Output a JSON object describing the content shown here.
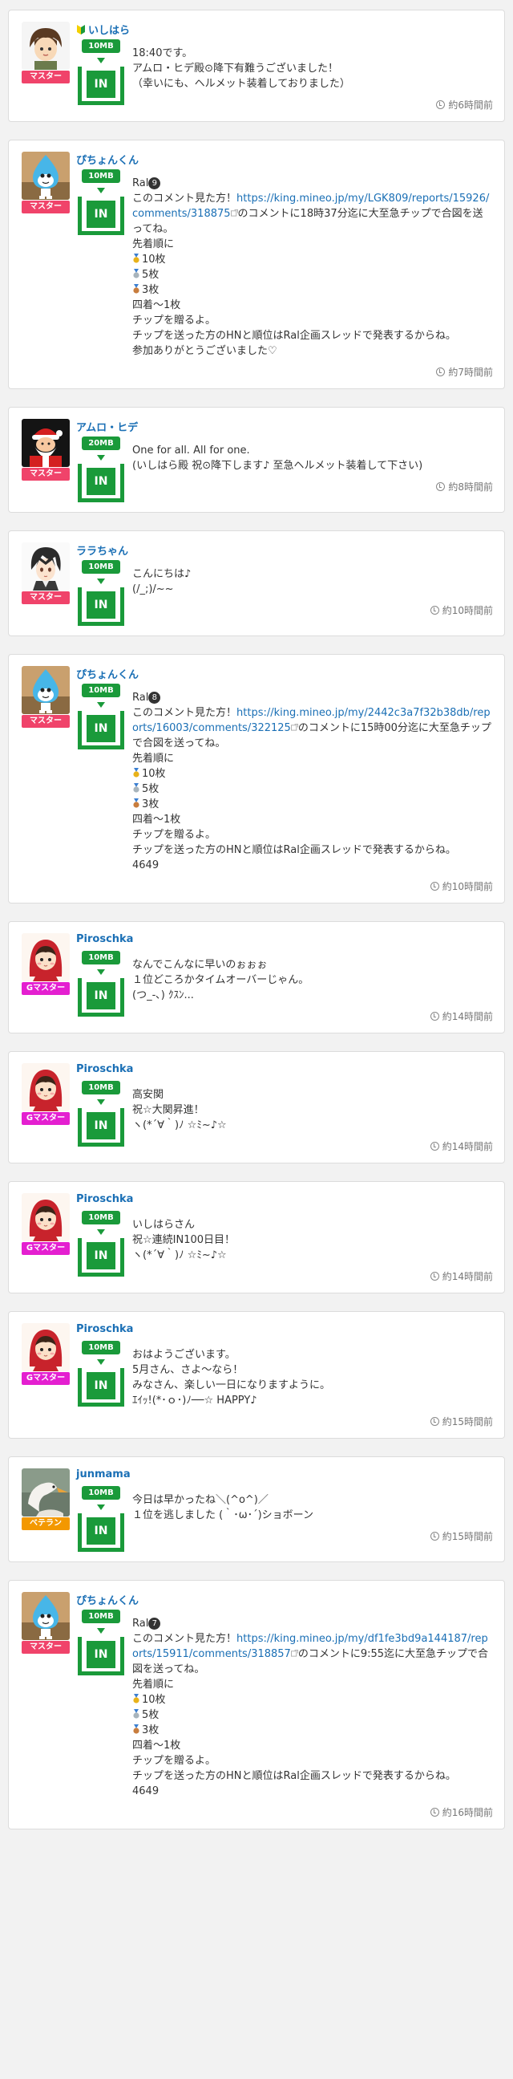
{
  "colors": {
    "master": "#f0436a",
    "g_master": "#e41fd0",
    "veteran": "#f39800",
    "green": "#1a9a3a",
    "link": "#1a6fb5"
  },
  "posts": [
    {
      "name": "いしはら",
      "rank": "マスター",
      "rank_type": "master",
      "mb": "10MB",
      "in": "IN",
      "avatar": "avatar-boy",
      "lines": [
        "18:40です。",
        "アムロ・ヒデ殿⊙降下有難うございました！",
        "（幸いにも、ヘルメット装着しておりました）"
      ],
      "time": "約6時間前"
    },
    {
      "name": "ぴちょんくん",
      "rank": "マスター",
      "rank_type": "master",
      "mb": "10MB",
      "in": "IN",
      "avatar": "avatar-drop",
      "ral_label": "Ral",
      "ral_num": "9",
      "pre": "このコメント見た方！",
      "url": "https://king.mineo.jp/my/LGK809/reports/15926/comments/318875",
      "post": "のコメントに18時37分迄に大至急チップで合図を送ってね。",
      "lines": [
        "先着順に",
        "10枚",
        "5枚",
        "3枚",
        "四着〜1枚",
        "チップを贈るよ。",
        "チップを送った方のHNと順位はRal企画スレッドで発表するからね。",
        "参加ありがとうございました♡"
      ],
      "time": "約7時間前"
    },
    {
      "name": "アムロ・ヒデ",
      "rank": "マスター",
      "rank_type": "master",
      "mb": "20MB",
      "in": "IN",
      "avatar": "avatar-santa",
      "lines": [
        "One for all. All for one.",
        "(いしはら殿 祝⊙降下します♪ 至急ヘルメット装着して下さい)"
      ],
      "time": "約8時間前"
    },
    {
      "name": "ララちゃん",
      "rank": "マスター",
      "rank_type": "master",
      "mb": "10MB",
      "in": "IN",
      "avatar": "avatar-anime",
      "lines": [
        "こんにちは♪",
        "(/_;)/~~"
      ],
      "time": "約10時間前"
    },
    {
      "name": "ぴちょんくん",
      "rank": "マスター",
      "rank_type": "master",
      "mb": "10MB",
      "in": "IN",
      "avatar": "avatar-drop",
      "ral_label": "Ral",
      "ral_num": "8",
      "pre": "このコメント見た方！",
      "url": "https://king.mineo.jp/my/2442c3a7f32b38db/reports/16003/comments/322125",
      "post": "のコメントに15時00分迄に大至急チップで合図を送ってね。",
      "lines": [
        "先着順に",
        "10枚",
        "5枚",
        "3枚",
        "四着〜1枚",
        "チップを贈るよ。",
        "チップを送った方のHNと順位はRal企画スレッドで発表するからね。",
        "4649"
      ],
      "time": "約10時間前"
    },
    {
      "name": "Piroschka",
      "rank": "Gマスター",
      "rank_type": "g_master",
      "mb": "10MB",
      "in": "IN",
      "avatar": "avatar-hood",
      "lines": [
        "なんでこんなに早いのぉぉぉ",
        "１位どころかタイムオーバーじゃん。",
        "(つ_-､) ｸｽﾝ..."
      ],
      "time": "約14時間前"
    },
    {
      "name": "Piroschka",
      "rank": "Gマスター",
      "rank_type": "g_master",
      "mb": "10MB",
      "in": "IN",
      "avatar": "avatar-hood",
      "lines": [
        "高安関",
        "祝☆大関昇進！",
        "ヽ(*´∀｀)ﾉ ☆ﾐ~♪☆"
      ],
      "time": "約14時間前"
    },
    {
      "name": "Piroschka",
      "rank": "Gマスター",
      "rank_type": "g_master",
      "mb": "10MB",
      "in": "IN",
      "avatar": "avatar-hood",
      "lines": [
        "いしはらさん",
        "祝☆連続IN100日目！",
        "ヽ(*´∀｀)ﾉ ☆ﾐ~♪☆"
      ],
      "time": "約14時間前"
    },
    {
      "name": "Piroschka",
      "rank": "Gマスター",
      "rank_type": "g_master",
      "mb": "10MB",
      "in": "IN",
      "avatar": "avatar-hood",
      "lines": [
        "おはようございます。",
        "5月さん、さよ〜なら！",
        "みなさん、楽しい一日になりますように。",
        "ｴｲｯ!(*･ｏ･)ﾉ──☆ HAPPY♪"
      ],
      "time": "約15時間前"
    },
    {
      "name": "junmama",
      "rank": "ベテラン",
      "rank_type": "veteran",
      "mb": "10MB",
      "in": "IN",
      "avatar": "avatar-bird",
      "lines": [
        "今日は早かったね＼(^o^)／",
        "１位を逃しました (｀･ω･´)ショボーン"
      ],
      "time": "約15時間前"
    },
    {
      "name": "ぴちょんくん",
      "rank": "マスター",
      "rank_type": "master",
      "mb": "10MB",
      "in": "IN",
      "avatar": "avatar-drop",
      "ral_label": "Ral",
      "ral_num": "7",
      "pre": "このコメント見た方！",
      "url": "https://king.mineo.jp/my/df1fe3bd9a144187/reports/15911/comments/318857",
      "post": "のコメントに9:55迄に大至急チップで合図を送ってね。",
      "lines": [
        "先着順に",
        "10枚",
        "5枚",
        "3枚",
        "四着〜1枚",
        "チップを贈るよ。",
        "チップを送った方のHNと順位はRal企画スレッドで発表するからね。",
        "4649"
      ],
      "time": "約16時間前"
    }
  ]
}
